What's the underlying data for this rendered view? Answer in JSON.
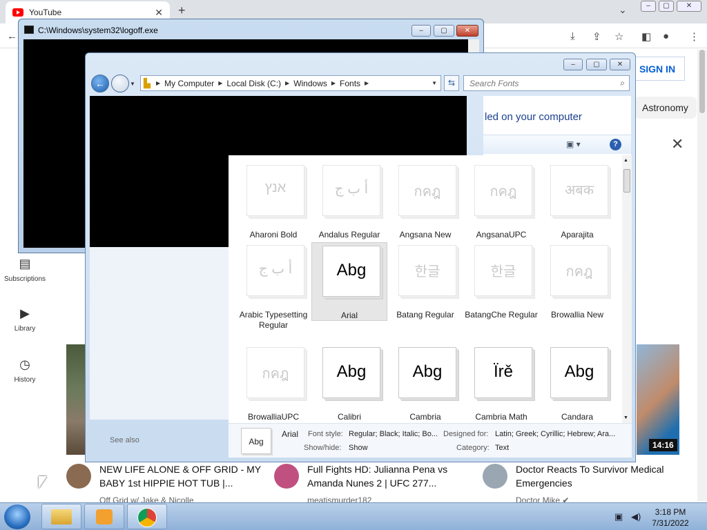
{
  "browser": {
    "tab_title": "YouTube",
    "tab_close": "✕",
    "new_tab": "+",
    "tab_menu": "⌄",
    "win_min": "–",
    "win_max": "▢",
    "win_close": "✕"
  },
  "youtube": {
    "sign_in": "SIGN IN",
    "chip": "Astronomy",
    "close": "✕",
    "sidebar": [
      {
        "label": "Subscriptions",
        "icon": "subscriptions-icon"
      },
      {
        "label": "Library",
        "icon": "library-icon"
      },
      {
        "label": "History",
        "icon": "history-icon"
      }
    ],
    "see_also": "See also",
    "duration": "14:16",
    "videos": [
      {
        "title": "NEW LIFE ALONE & OFF GRID - MY BABY 1st HIPPIE HOT TUB |...",
        "channel": "Off Grid w/ Jake & Nicolle"
      },
      {
        "title": "Full Fights HD: Julianna Pena vs Amanda Nunes 2 | UFC 277...",
        "channel": "meatismurder182"
      },
      {
        "title": "Doctor Reacts To Survivor Medical Emergencies",
        "channel": "Doctor Mike ✔"
      }
    ]
  },
  "cmd": {
    "title": "C:\\Windows\\system32\\logoff.exe"
  },
  "explorer": {
    "breadcrumb": [
      "My Computer",
      "Local Disk (C:)",
      "Windows",
      "Fonts"
    ],
    "search_placeholder": "Search Fonts",
    "installed_text": "led on your computer",
    "help": "?",
    "fonts": [
      {
        "name": "Aharoni Bold",
        "glyph": "אנץ",
        "faded": true
      },
      {
        "name": "Andalus Regular",
        "glyph": "أ ب ج",
        "faded": true
      },
      {
        "name": "Angsana New",
        "glyph": "กคฎ",
        "faded": true
      },
      {
        "name": "AngsanaUPC",
        "glyph": "กคฎ",
        "faded": true
      },
      {
        "name": "Aparajita",
        "glyph": "अबक",
        "faded": true
      },
      {
        "name": "Arabic Typesetting Regular",
        "glyph": "أ ب ج",
        "faded": true
      },
      {
        "name": "Arial",
        "glyph": "Abg",
        "faded": false,
        "selected": true
      },
      {
        "name": "Batang Regular",
        "glyph": "한글",
        "faded": true
      },
      {
        "name": "BatangChe Regular",
        "glyph": "한글",
        "faded": true
      },
      {
        "name": "Browallia New",
        "glyph": "กคฎ",
        "faded": true
      },
      {
        "name": "BrowalliaUPC",
        "glyph": "กคฎ",
        "faded": true
      },
      {
        "name": "Calibri",
        "glyph": "Abg",
        "faded": false
      },
      {
        "name": "Cambria",
        "glyph": "Abg",
        "faded": false
      },
      {
        "name": "Cambria Math",
        "glyph": "Ïrě",
        "faded": false
      },
      {
        "name": "Candara",
        "glyph": "Abg",
        "faded": false
      }
    ],
    "details": {
      "thumb_glyph": "Abg",
      "name": "Arial",
      "font_style_label": "Font style:",
      "font_style": "Regular; Black; Italic; Bo...",
      "designed_for_label": "Designed for:",
      "designed_for": "Latin; Greek; Cyrillic; Hebrew; Ara...",
      "show_hide_label": "Show/hide:",
      "show_hide": "Show",
      "category_label": "Category:",
      "category": "Text"
    }
  },
  "taskbar": {
    "time": "3:18 PM",
    "date": "7/31/2022"
  }
}
